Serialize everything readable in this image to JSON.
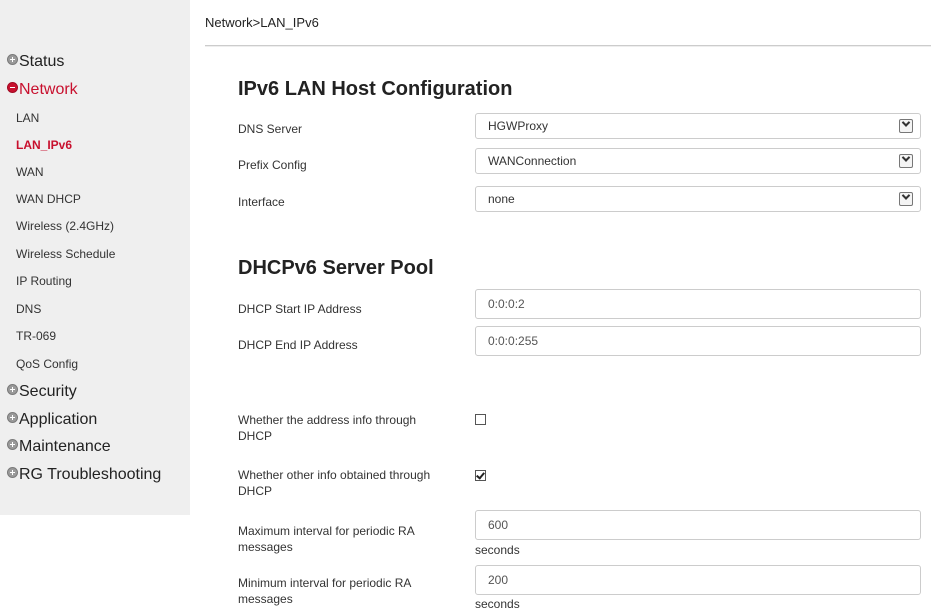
{
  "breadcrumb": "Network>LAN_IPv6",
  "sidebar": {
    "status": "Status",
    "network": "Network",
    "network_items": [
      "LAN",
      "LAN_IPv6",
      "WAN",
      "WAN DHCP",
      "Wireless (2.4GHz)",
      "Wireless Schedule",
      "IP Routing",
      "DNS",
      "TR-069",
      "QoS Config"
    ],
    "security": "Security",
    "application": "Application",
    "maintenance": "Maintenance",
    "rg_troubleshooting": "RG Troubleshooting",
    "active_item": "LAN_IPv6"
  },
  "host_config": {
    "title": "IPv6 LAN Host Configuration",
    "dns_server": {
      "label": "DNS Server",
      "value": "HGWProxy"
    },
    "prefix_config": {
      "label": "Prefix Config",
      "value": "WANConnection"
    },
    "interface": {
      "label": "Interface",
      "value": "none"
    }
  },
  "server_pool": {
    "title": "DHCPv6 Server Pool",
    "start_ip": {
      "label": "DHCP Start IP Address",
      "value": "0:0:0:2"
    },
    "end_ip": {
      "label": "DHCP End IP Address",
      "value": "0:0:0:255"
    }
  },
  "options": {
    "address_info": {
      "label_line1": "Whether the address info through",
      "label_line2": "DHCP",
      "checked": false
    },
    "other_info": {
      "label_line1": "Whether other info obtained through",
      "label_line2": "DHCP",
      "checked": true
    },
    "max_ra": {
      "label_line1": "Maximum interval for periodic RA",
      "label_line2": "messages",
      "value": "600",
      "unit": "seconds"
    },
    "min_ra": {
      "label_line1": "Minimum interval for periodic RA",
      "label_line2": "messages",
      "value": "200",
      "unit": "seconds"
    }
  }
}
